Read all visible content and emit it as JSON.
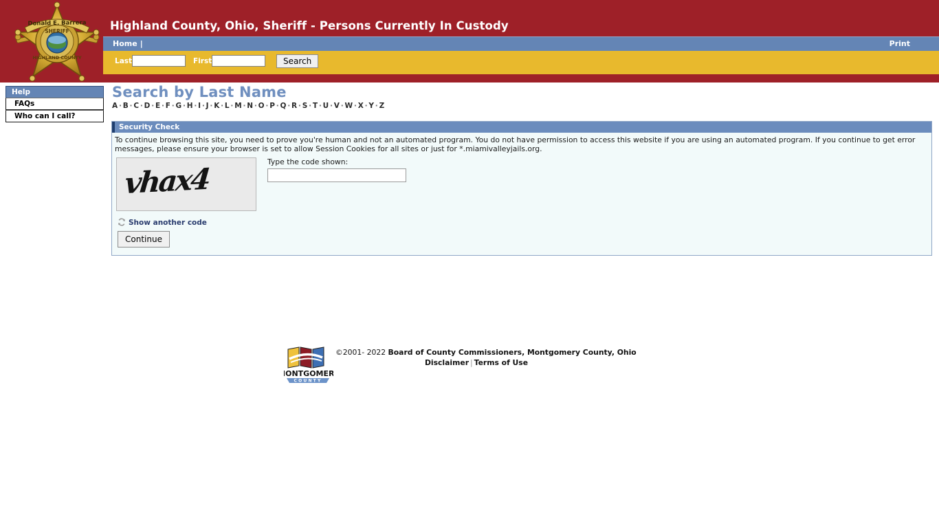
{
  "header": {
    "title": "Highland County, Ohio, Sheriff - Persons Currently In Custody",
    "badge": {
      "name": "sheriff-badge",
      "banner_text": "Donald E. Barrera",
      "rank_text": "SHERIFF",
      "county_text": "HIGHLAND COUNTY"
    },
    "colors": {
      "header_red": "#9E2028",
      "nav_blue": "#6485B5",
      "search_gold": "#E8B92D"
    }
  },
  "nav": {
    "home_label": "Home",
    "separator": "|",
    "print_label": "Print"
  },
  "search": {
    "last_label": "Last",
    "last_value": "",
    "last_placeholder": "",
    "first_label": "First",
    "first_value": "",
    "first_placeholder": "",
    "button_label": "Search"
  },
  "sidebar": {
    "header": "Help",
    "items": [
      {
        "label": "FAQs"
      },
      {
        "label": "Who can I call?"
      }
    ]
  },
  "main": {
    "page_title": "Search by Last Name",
    "alphabet": [
      "A",
      "B",
      "C",
      "D",
      "E",
      "F",
      "G",
      "H",
      "I",
      "J",
      "K",
      "L",
      "M",
      "N",
      "O",
      "P",
      "Q",
      "R",
      "S",
      "T",
      "U",
      "V",
      "W",
      "X",
      "Y",
      "Z"
    ],
    "alphabet_separator": "·"
  },
  "security_panel": {
    "header": "Security Check",
    "body_text": "To continue browsing this site, you need to prove you're human and not an automated program. You do not have permission to access this website if you are using an automated program. If you continue to get error messages, please ensure your browser is set to allow Session Cookies for all sites or just for *.miamivalleyjails.org.",
    "captcha_code": "vhax4",
    "refresh_label": "Show another code",
    "refresh_icon": "refresh-icon",
    "code_label": "Type the code shown:",
    "code_value": "",
    "code_placeholder": "",
    "continue_label": "Continue",
    "colors": {
      "panel_head_blue": "#6B8CBD",
      "panel_bg": "#F2FAFA"
    }
  },
  "footer": {
    "copyright_symbol": "©",
    "copyright_years": "2001- 2022",
    "copyright_owner": "Board of County Commissioners, Montgomery County, Ohio",
    "disclaimer_label": "Disclaimer",
    "links_separator": "|",
    "terms_label": "Terms of Use",
    "logo": {
      "name": "montgomery-county-logo",
      "title_text": "MONTGOMERY",
      "subtitle_text": "COUNTY"
    }
  }
}
